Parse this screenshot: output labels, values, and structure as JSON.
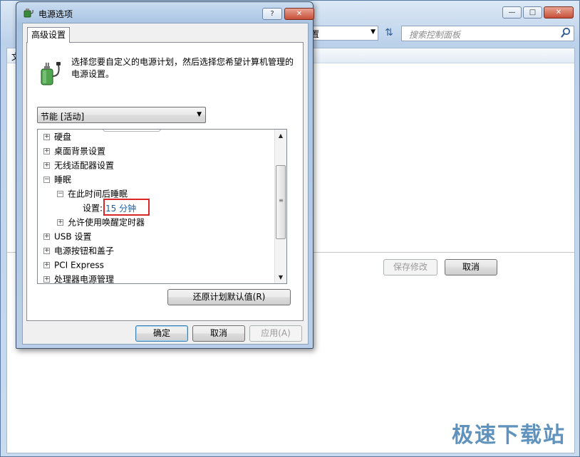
{
  "background": {
    "address_text": "置",
    "search_placeholder": "搜索控制面板",
    "menu_item": "文",
    "save_button": "保存修改",
    "cancel_button": "取消",
    "caption": {
      "minimize": "▭",
      "maximize": "□",
      "close": "✕"
    }
  },
  "dialog": {
    "title": "电源选项",
    "help_button": "?",
    "close_button": "✕",
    "tab": "高级设置",
    "intro_text": "选择您要自定义的电源计划，然后选择您希望计算机管理的电源设置。",
    "plan_select": "节能 [活动]",
    "tree": [
      {
        "label": "硬盘",
        "expander": "+",
        "level": 0
      },
      {
        "label": "桌面背景设置",
        "expander": "+",
        "level": 0
      },
      {
        "label": "无线适配器设置",
        "expander": "+",
        "level": 0
      },
      {
        "label": "睡眠",
        "expander": "−",
        "level": 0
      },
      {
        "label": "在此时间后睡眠",
        "expander": "−",
        "level": 1
      },
      {
        "setting_label": "设置:",
        "setting_value": "15 分钟",
        "level": 2
      },
      {
        "label": "允许使用唤醒定时器",
        "expander": "+",
        "level": 1
      },
      {
        "label": "USB 设置",
        "expander": "+",
        "level": 0
      },
      {
        "label": "电源按钮和盖子",
        "expander": "+",
        "level": 0
      },
      {
        "label": "PCI Express",
        "expander": "+",
        "level": 0
      },
      {
        "label": "处理器电源管理",
        "expander": "+",
        "level": 0
      }
    ],
    "restore_button": "还原计划默认值(R)",
    "ok_button": "确定",
    "cancel_button": "取消",
    "apply_button": "应用(A)"
  },
  "watermark": "极速下载站",
  "colors": {
    "setting_value": "#1a5ea8",
    "highlight": "#d9262b"
  }
}
